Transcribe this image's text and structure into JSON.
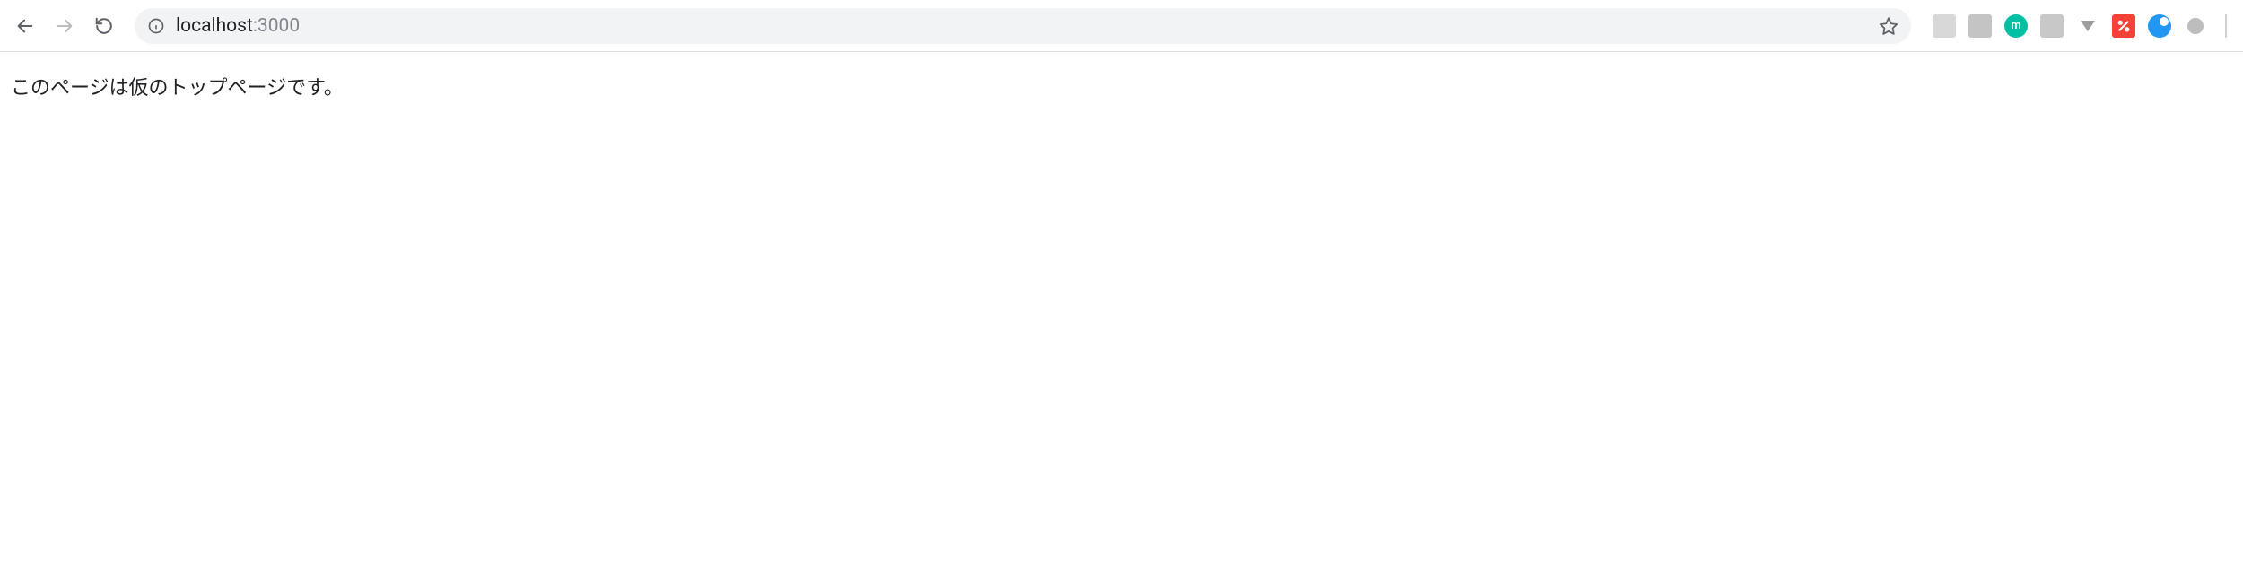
{
  "addressbar": {
    "host": "localhost",
    "port": ":3000"
  },
  "extensions": {
    "teal_letter": "m"
  },
  "page": {
    "body_text": "このページは仮のトップページです。"
  }
}
